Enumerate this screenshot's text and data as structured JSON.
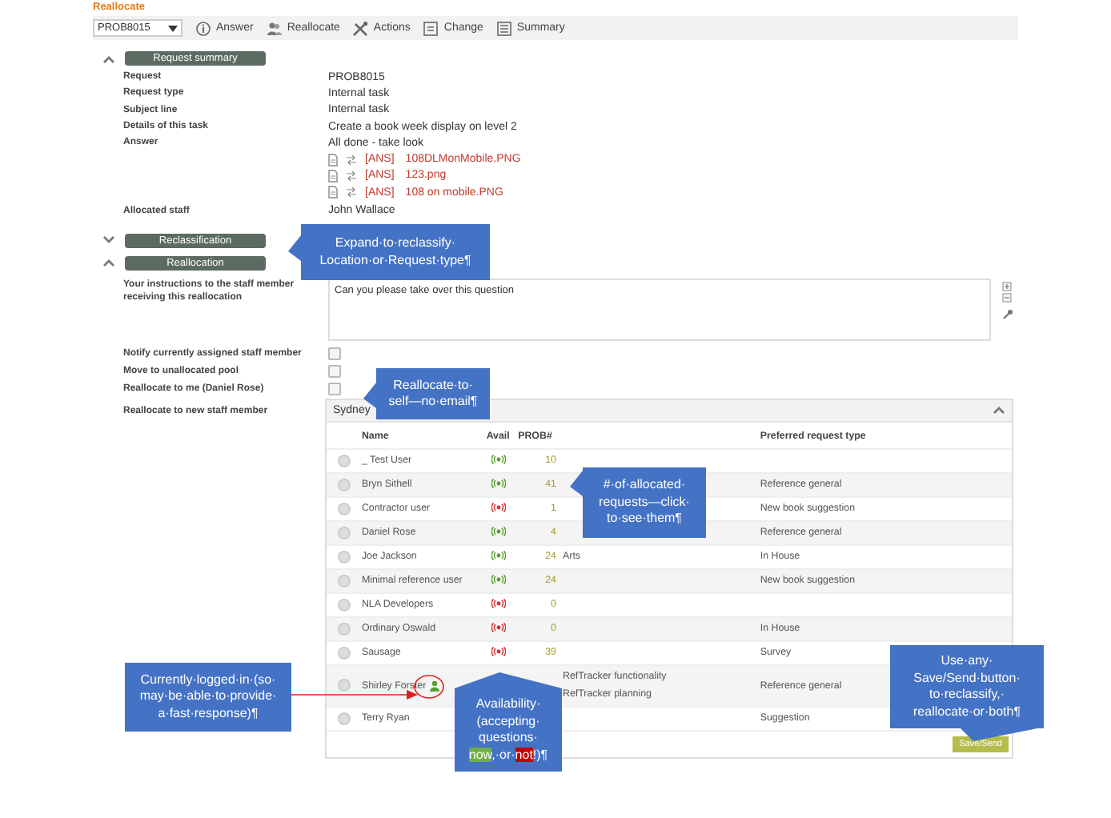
{
  "title": "Reallocate",
  "toolbar": {
    "request_select": "PROB8015",
    "buttons": [
      {
        "label": "Answer",
        "kind": "info"
      },
      {
        "label": "Reallocate",
        "kind": "people"
      },
      {
        "label": "Actions",
        "kind": "tools"
      },
      {
        "label": "Change",
        "kind": "document"
      },
      {
        "label": "Summary",
        "kind": "list"
      }
    ]
  },
  "request_summary": {
    "heading": "Request summary",
    "expanded": true,
    "fields": [
      {
        "label": "Request",
        "value": "PROB8015"
      },
      {
        "label": "Request type",
        "value": "Internal task"
      },
      {
        "label": "Subject line",
        "value": "Internal task"
      },
      {
        "label": "Details of this task",
        "value": "Create a book week display on level 2"
      },
      {
        "label": "Answer",
        "value": "All done - take look"
      }
    ],
    "attachments": [
      {
        "tag": "[ANS]",
        "name": "108DLMonMobile.PNG"
      },
      {
        "tag": "[ANS]",
        "name": "123.png"
      },
      {
        "tag": "[ANS]",
        "name": "108 on mobile.PNG"
      }
    ],
    "allocated_staff": {
      "label": "Allocated staff",
      "value": "John Wallace"
    }
  },
  "reclassification": {
    "heading": "Reclassification",
    "expanded": false
  },
  "reallocation": {
    "heading": "Reallocation",
    "expanded": true,
    "instructions": {
      "label": "Your instructions to the staff member receiving this reallocation",
      "value": "Can you please take over this question"
    },
    "options": [
      {
        "label": "Notify currently assigned staff member",
        "checked": false
      },
      {
        "label": "Move to unallocated pool",
        "checked": false
      },
      {
        "label": "Reallocate to me (Daniel Rose)",
        "checked": false
      }
    ],
    "new_staff_label": "Reallocate to new staff member",
    "staff_panel": {
      "heading": "Sydney",
      "expanded": true,
      "columns": [
        "Name",
        "Avail",
        "PROB#",
        "Preferred request type"
      ],
      "rows": [
        {
          "name": "_ Test User",
          "selected": false,
          "logged_in": false,
          "available": true,
          "count": "10",
          "preferred": ""
        },
        {
          "name": "Bryn Sithell",
          "selected": false,
          "logged_in": false,
          "available": true,
          "count": "41",
          "preferred": "Reference general"
        },
        {
          "name": "Contractor user",
          "selected": false,
          "logged_in": false,
          "available": false,
          "count": "1",
          "preferred": "New book suggestion"
        },
        {
          "name": "Daniel Rose",
          "selected": false,
          "logged_in": false,
          "available": true,
          "count": "4",
          "preferred": "Reference general"
        },
        {
          "name": "Joe Jackson",
          "selected": false,
          "logged_in": false,
          "available": true,
          "count": "24",
          "column_4": [
            "Arts"
          ],
          "preferred": "In House"
        },
        {
          "name": "Minimal reference user",
          "selected": false,
          "logged_in": false,
          "available": true,
          "count": "24",
          "preferred": "New book suggestion"
        },
        {
          "name": "NLA Developers",
          "selected": false,
          "logged_in": false,
          "available": false,
          "count": "0",
          "preferred": ""
        },
        {
          "name": "Ordinary Oswald",
          "selected": false,
          "logged_in": false,
          "available": false,
          "count": "0",
          "preferred": "In House"
        },
        {
          "name": "Sausage",
          "selected": false,
          "logged_in": false,
          "available": false,
          "count": "39",
          "preferred": "Survey"
        },
        {
          "name": "Shirley Forster",
          "selected": false,
          "logged_in": true,
          "column_4": [
            "RefTracker functionality",
            "RefTracker planning"
          ],
          "preferred": "Reference general"
        },
        {
          "name": "Terry Ryan",
          "selected": false,
          "logged_in": false,
          "preferred": "Suggestion"
        }
      ]
    },
    "save_button": "Save/Send"
  },
  "callouts": [
    {
      "kind": "left",
      "lines": [
        [
          {
            "text": "Expand·to·reclassify·"
          }
        ],
        [
          {
            "text": "Location·or·Request·type¶"
          }
        ]
      ]
    },
    {
      "kind": "left",
      "lines": [
        [
          {
            "text": "Reallocate·to·"
          }
        ],
        [
          {
            "text": "self—no·email¶"
          }
        ]
      ]
    },
    {
      "kind": "left",
      "lines": [
        [
          {
            "text": "#·of·allocated·"
          }
        ],
        [
          {
            "text": "requests—click·"
          }
        ],
        [
          {
            "text": "to·see·them¶"
          }
        ]
      ]
    },
    {
      "kind": "leader",
      "lines": [
        [
          {
            "text": "Currently·logged·in·(so·"
          }
        ],
        [
          {
            "text": "may·be·able·to·provide·"
          }
        ],
        [
          {
            "text": "a·fast·response)¶"
          }
        ]
      ]
    },
    {
      "kind": "up",
      "lines": [
        [
          {
            "text": "Availability·"
          }
        ],
        [
          {
            "text": "(accepting·"
          }
        ],
        [
          {
            "text": "questions·"
          }
        ],
        [
          {
            "text": "now",
            "color": "#70ad47"
          },
          {
            "text": ",·or·"
          },
          {
            "text": "not",
            "color": "#c00000"
          },
          {
            "text": "!)¶"
          }
        ]
      ]
    },
    {
      "kind": "down",
      "lines": [
        [
          {
            "text": "Use·any·"
          }
        ],
        [
          {
            "text": "Save/Send·button·"
          }
        ],
        [
          {
            "text": "to·reclassify,·"
          }
        ],
        [
          {
            "text": "reallocate·or·both¶"
          }
        ]
      ]
    }
  ]
}
